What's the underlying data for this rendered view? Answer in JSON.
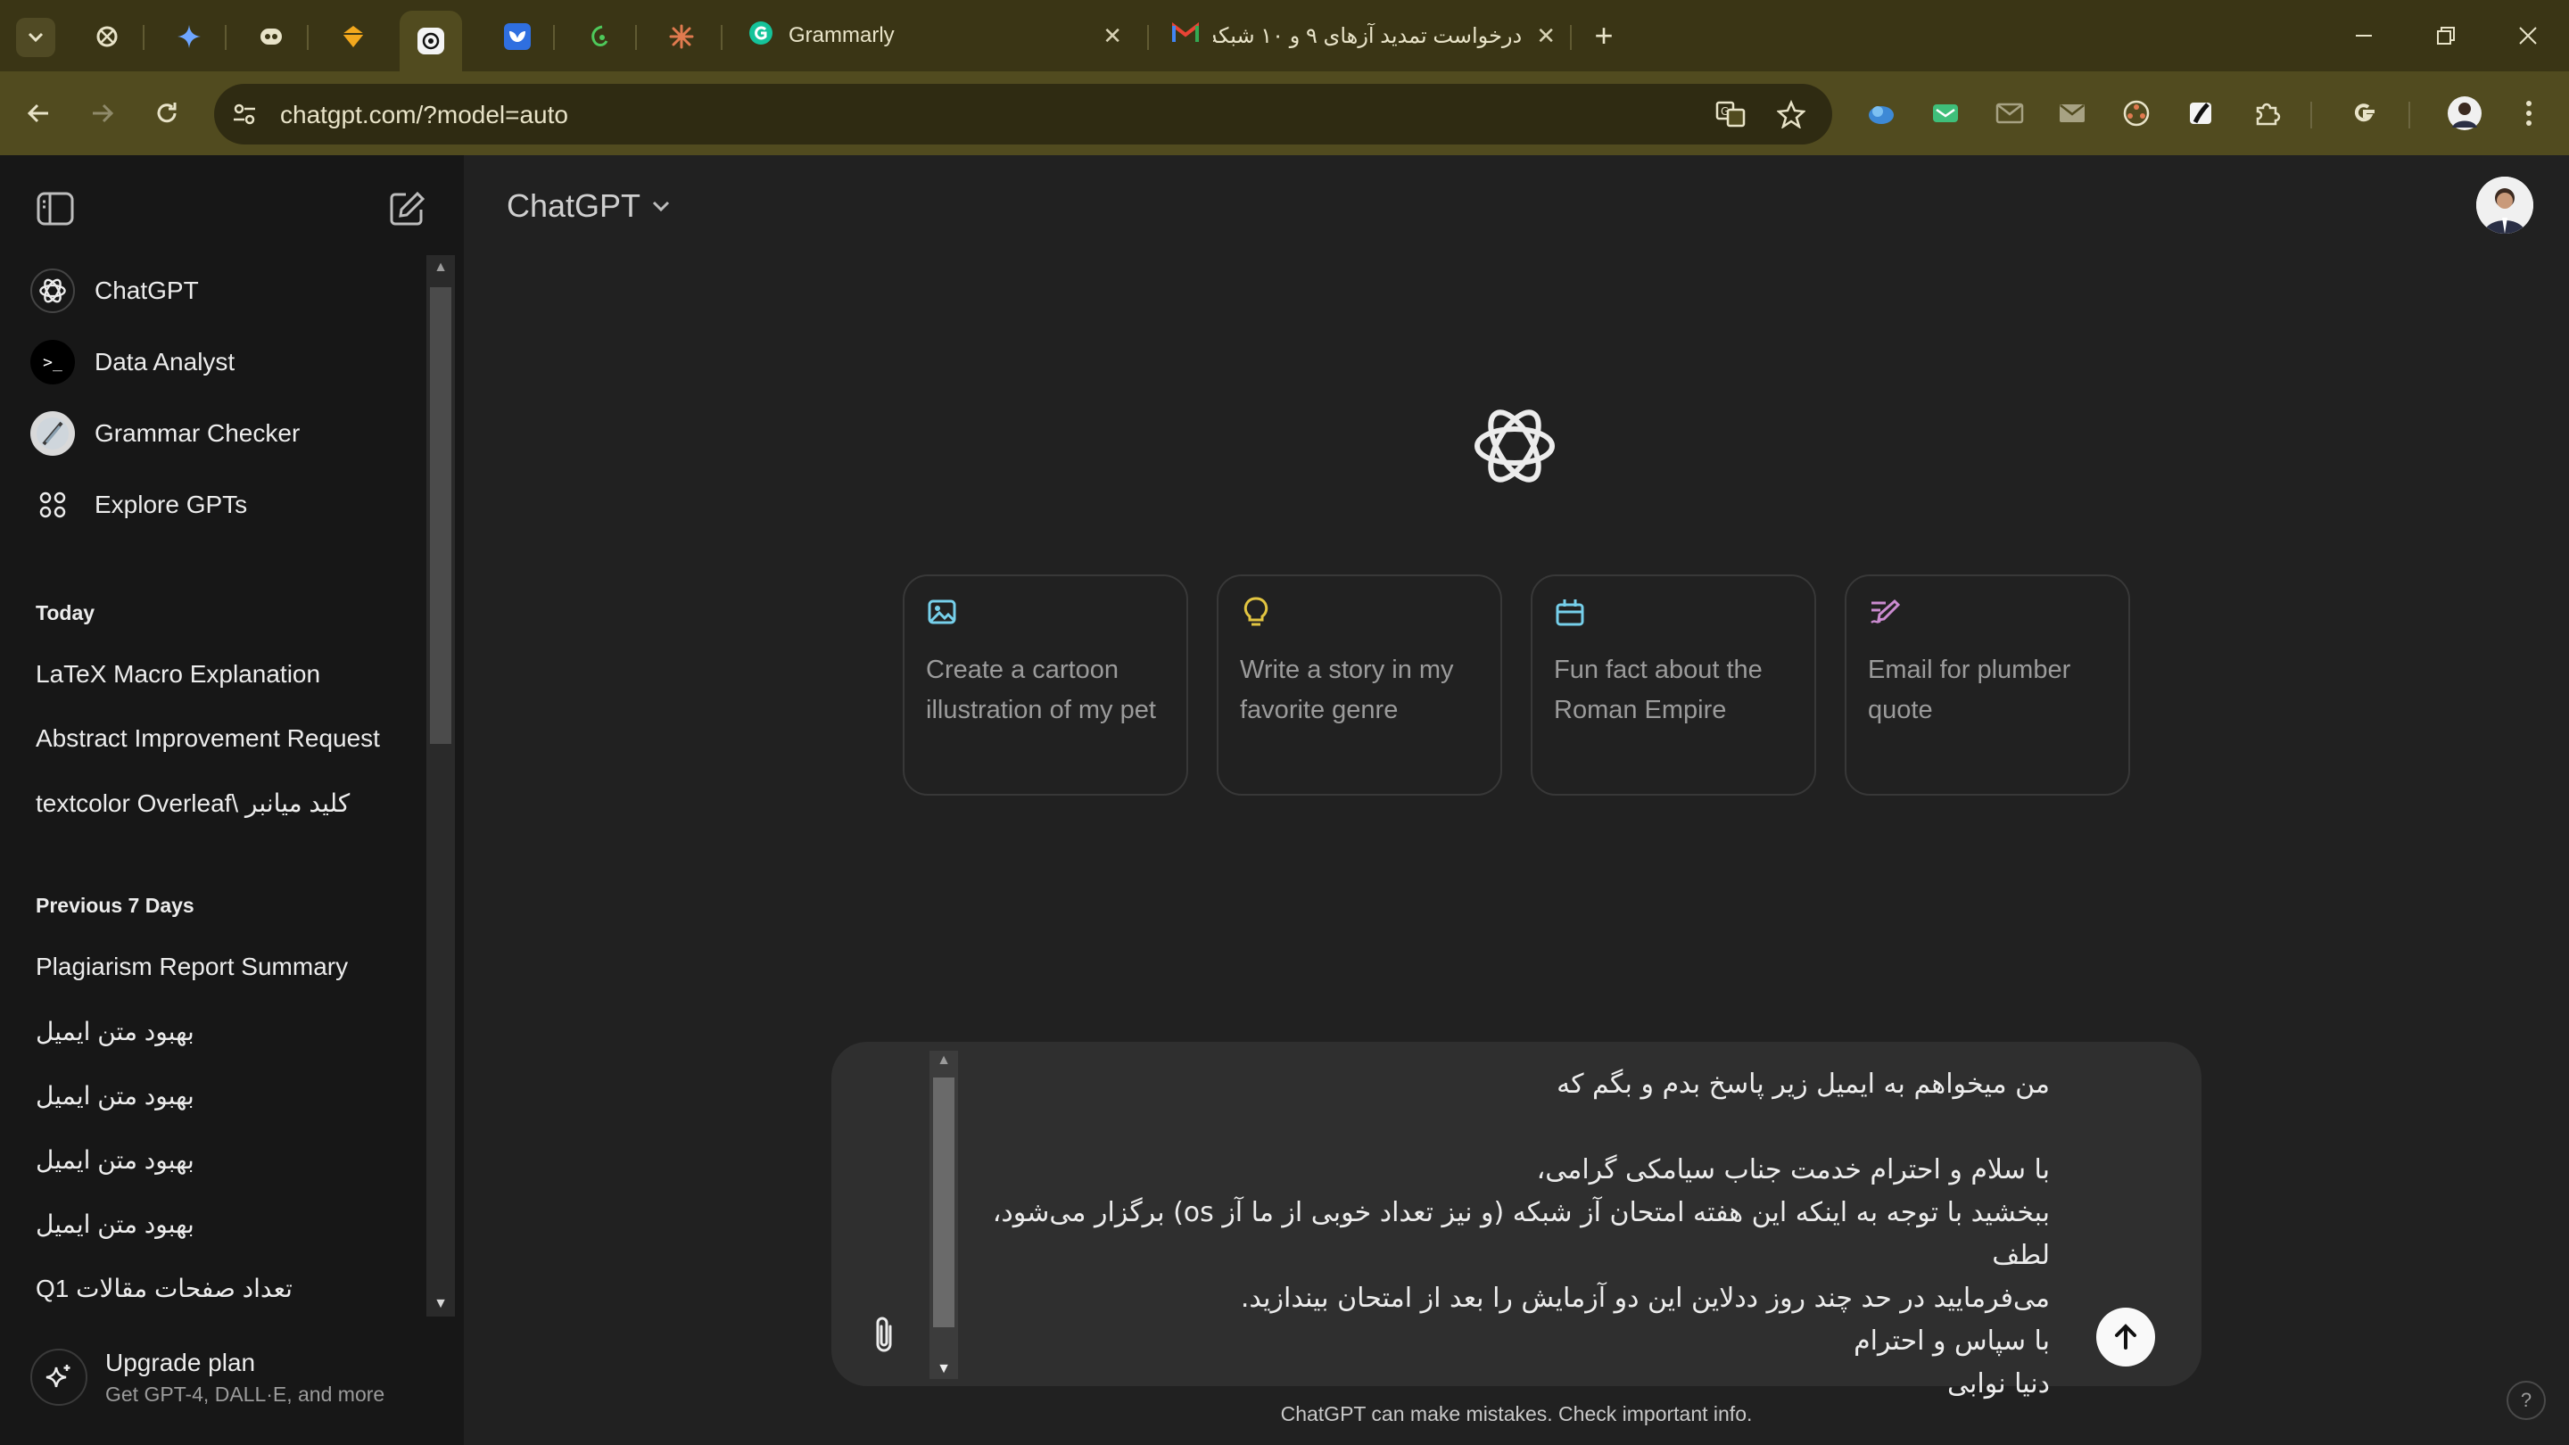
{
  "browser": {
    "tabs": [
      {
        "title": "Grammarly",
        "icon": "grammarly-icon"
      },
      {
        "title": "درخواست تمدید آزهای ۹ و ۱۰ شبکه",
        "icon": "gmail-icon"
      }
    ],
    "pinned_tabs": [
      "tab-icon-1",
      "gemini-icon",
      "tab-icon-3",
      "tab-icon-4",
      "chatgpt-icon",
      "tab-icon-6",
      "tab-icon-7",
      "claude-icon"
    ],
    "url": "chatgpt.com/?model=auto"
  },
  "sidebar": {
    "gpts": [
      {
        "label": "ChatGPT",
        "icon": "chatgpt-logo-icon"
      },
      {
        "label": "Data Analyst",
        "icon": "terminal-icon"
      },
      {
        "label": "Grammar Checker",
        "icon": "grammar-checker-icon"
      },
      {
        "label": "Explore GPTs",
        "icon": "grid-icon"
      }
    ],
    "sections": [
      {
        "heading": "Today",
        "items": [
          "LaTeX Macro Explanation",
          "Abstract Improvement Request",
          "textcolor Overleaf\\ کلید میانبر"
        ]
      },
      {
        "heading": "Previous 7 Days",
        "items": [
          "Plagiarism Report Summary",
          "بهبود متن ایمیل",
          "بهبود متن ایمیل",
          "بهبود متن ایمیل",
          "بهبود متن ایمیل",
          "تعداد صفحات مقالات Q1"
        ]
      }
    ],
    "upgrade": {
      "title": "Upgrade plan",
      "subtitle": "Get GPT-4, DALL·E, and more"
    }
  },
  "main": {
    "model_label": "ChatGPT",
    "cards": [
      {
        "text": "Create a cartoon illustration of my pet",
        "icon": "image-icon",
        "color": "#76d0eb"
      },
      {
        "text": "Write a story in my favorite genre",
        "icon": "lightbulb-icon",
        "color": "#e2c541"
      },
      {
        "text": "Fun fact about the Roman Empire",
        "icon": "graduation-icon",
        "color": "#76d0eb"
      },
      {
        "text": "Email for plumber quote",
        "icon": "pen-icon",
        "color": "#cb8bd0"
      }
    ],
    "composer": {
      "lines": [
        "من میخواهم به ایمیل زیر پاسخ بدم و بگم که",
        "",
        "با سلام و احترام خدمت جناب سیامکی گرامی،",
        "ببخشید با توجه به اینکه این هفته امتحان آز شبکه (و نیز تعداد خوبی از ما آز os) برگزار می‌شود، لطف",
        "می‌فرمایید در حد چند روز ددلاین این دو آزمایش را بعد از امتحان بیندازید.",
        "با سپاس و احترام",
        "دنیا نوابی"
      ]
    },
    "disclaimer": "ChatGPT can make mistakes. Check important info.",
    "help": "?"
  }
}
